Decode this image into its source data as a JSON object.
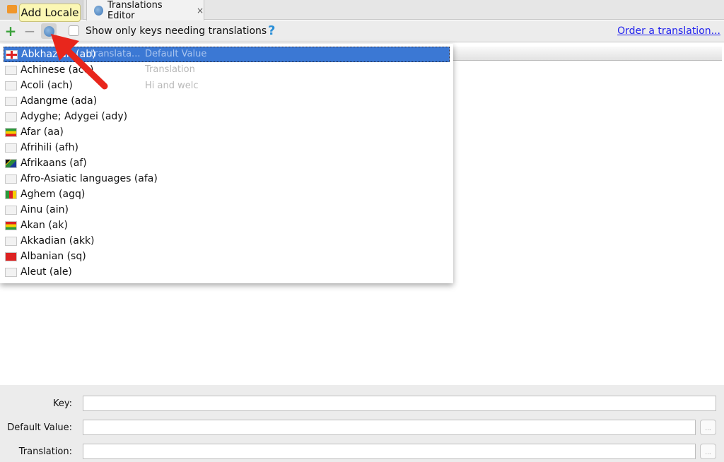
{
  "tabs": [
    {
      "label": "",
      "icon": "layout-file-icon"
    },
    {
      "label": "Translations Editor",
      "icon": "globe-icon",
      "close": "×"
    }
  ],
  "toolbar": {
    "add": "+",
    "remove": "−",
    "tooltip": "Add Locale",
    "checkbox_label": "Show only keys needing translations",
    "checkbox_checked": false,
    "help": "?",
    "order_link": "Order a translation..."
  },
  "background_table": {
    "header": [
      "translata...",
      "Default Value"
    ],
    "cells": [
      "Translation",
      "Hi and welc"
    ]
  },
  "locales": [
    {
      "label": "Abkhazian (ab)",
      "flag": "georgia",
      "selected": true
    },
    {
      "label": "Achinese (ace)",
      "flag": "none"
    },
    {
      "label": "Acoli (ach)",
      "flag": "none"
    },
    {
      "label": "Adangme (ada)",
      "flag": "none"
    },
    {
      "label": "Adyghe; Adygei (ady)",
      "flag": "none"
    },
    {
      "label": "Afar (aa)",
      "flag": "ethiopia"
    },
    {
      "label": "Afrihili (afh)",
      "flag": "none"
    },
    {
      "label": "Afrikaans (af)",
      "flag": "south-africa"
    },
    {
      "label": "Afro-Asiatic languages (afa)",
      "flag": "none"
    },
    {
      "label": "Aghem (agq)",
      "flag": "cameroon"
    },
    {
      "label": "Ainu (ain)",
      "flag": "none"
    },
    {
      "label": "Akan (ak)",
      "flag": "ghana"
    },
    {
      "label": "Akkadian (akk)",
      "flag": "none"
    },
    {
      "label": "Albanian (sq)",
      "flag": "albania"
    },
    {
      "label": "Aleut (ale)",
      "flag": "none"
    }
  ],
  "form": {
    "key_label": "Key:",
    "key_value": "",
    "default_label": "Default Value:",
    "default_value": "",
    "translation_label": "Translation:",
    "translation_value": "",
    "more_button": "..."
  },
  "colors": {
    "selection": "#3b78d4",
    "link": "#2222ee",
    "arrow": "#e8261c",
    "tooltip": "#fbf7b4"
  }
}
